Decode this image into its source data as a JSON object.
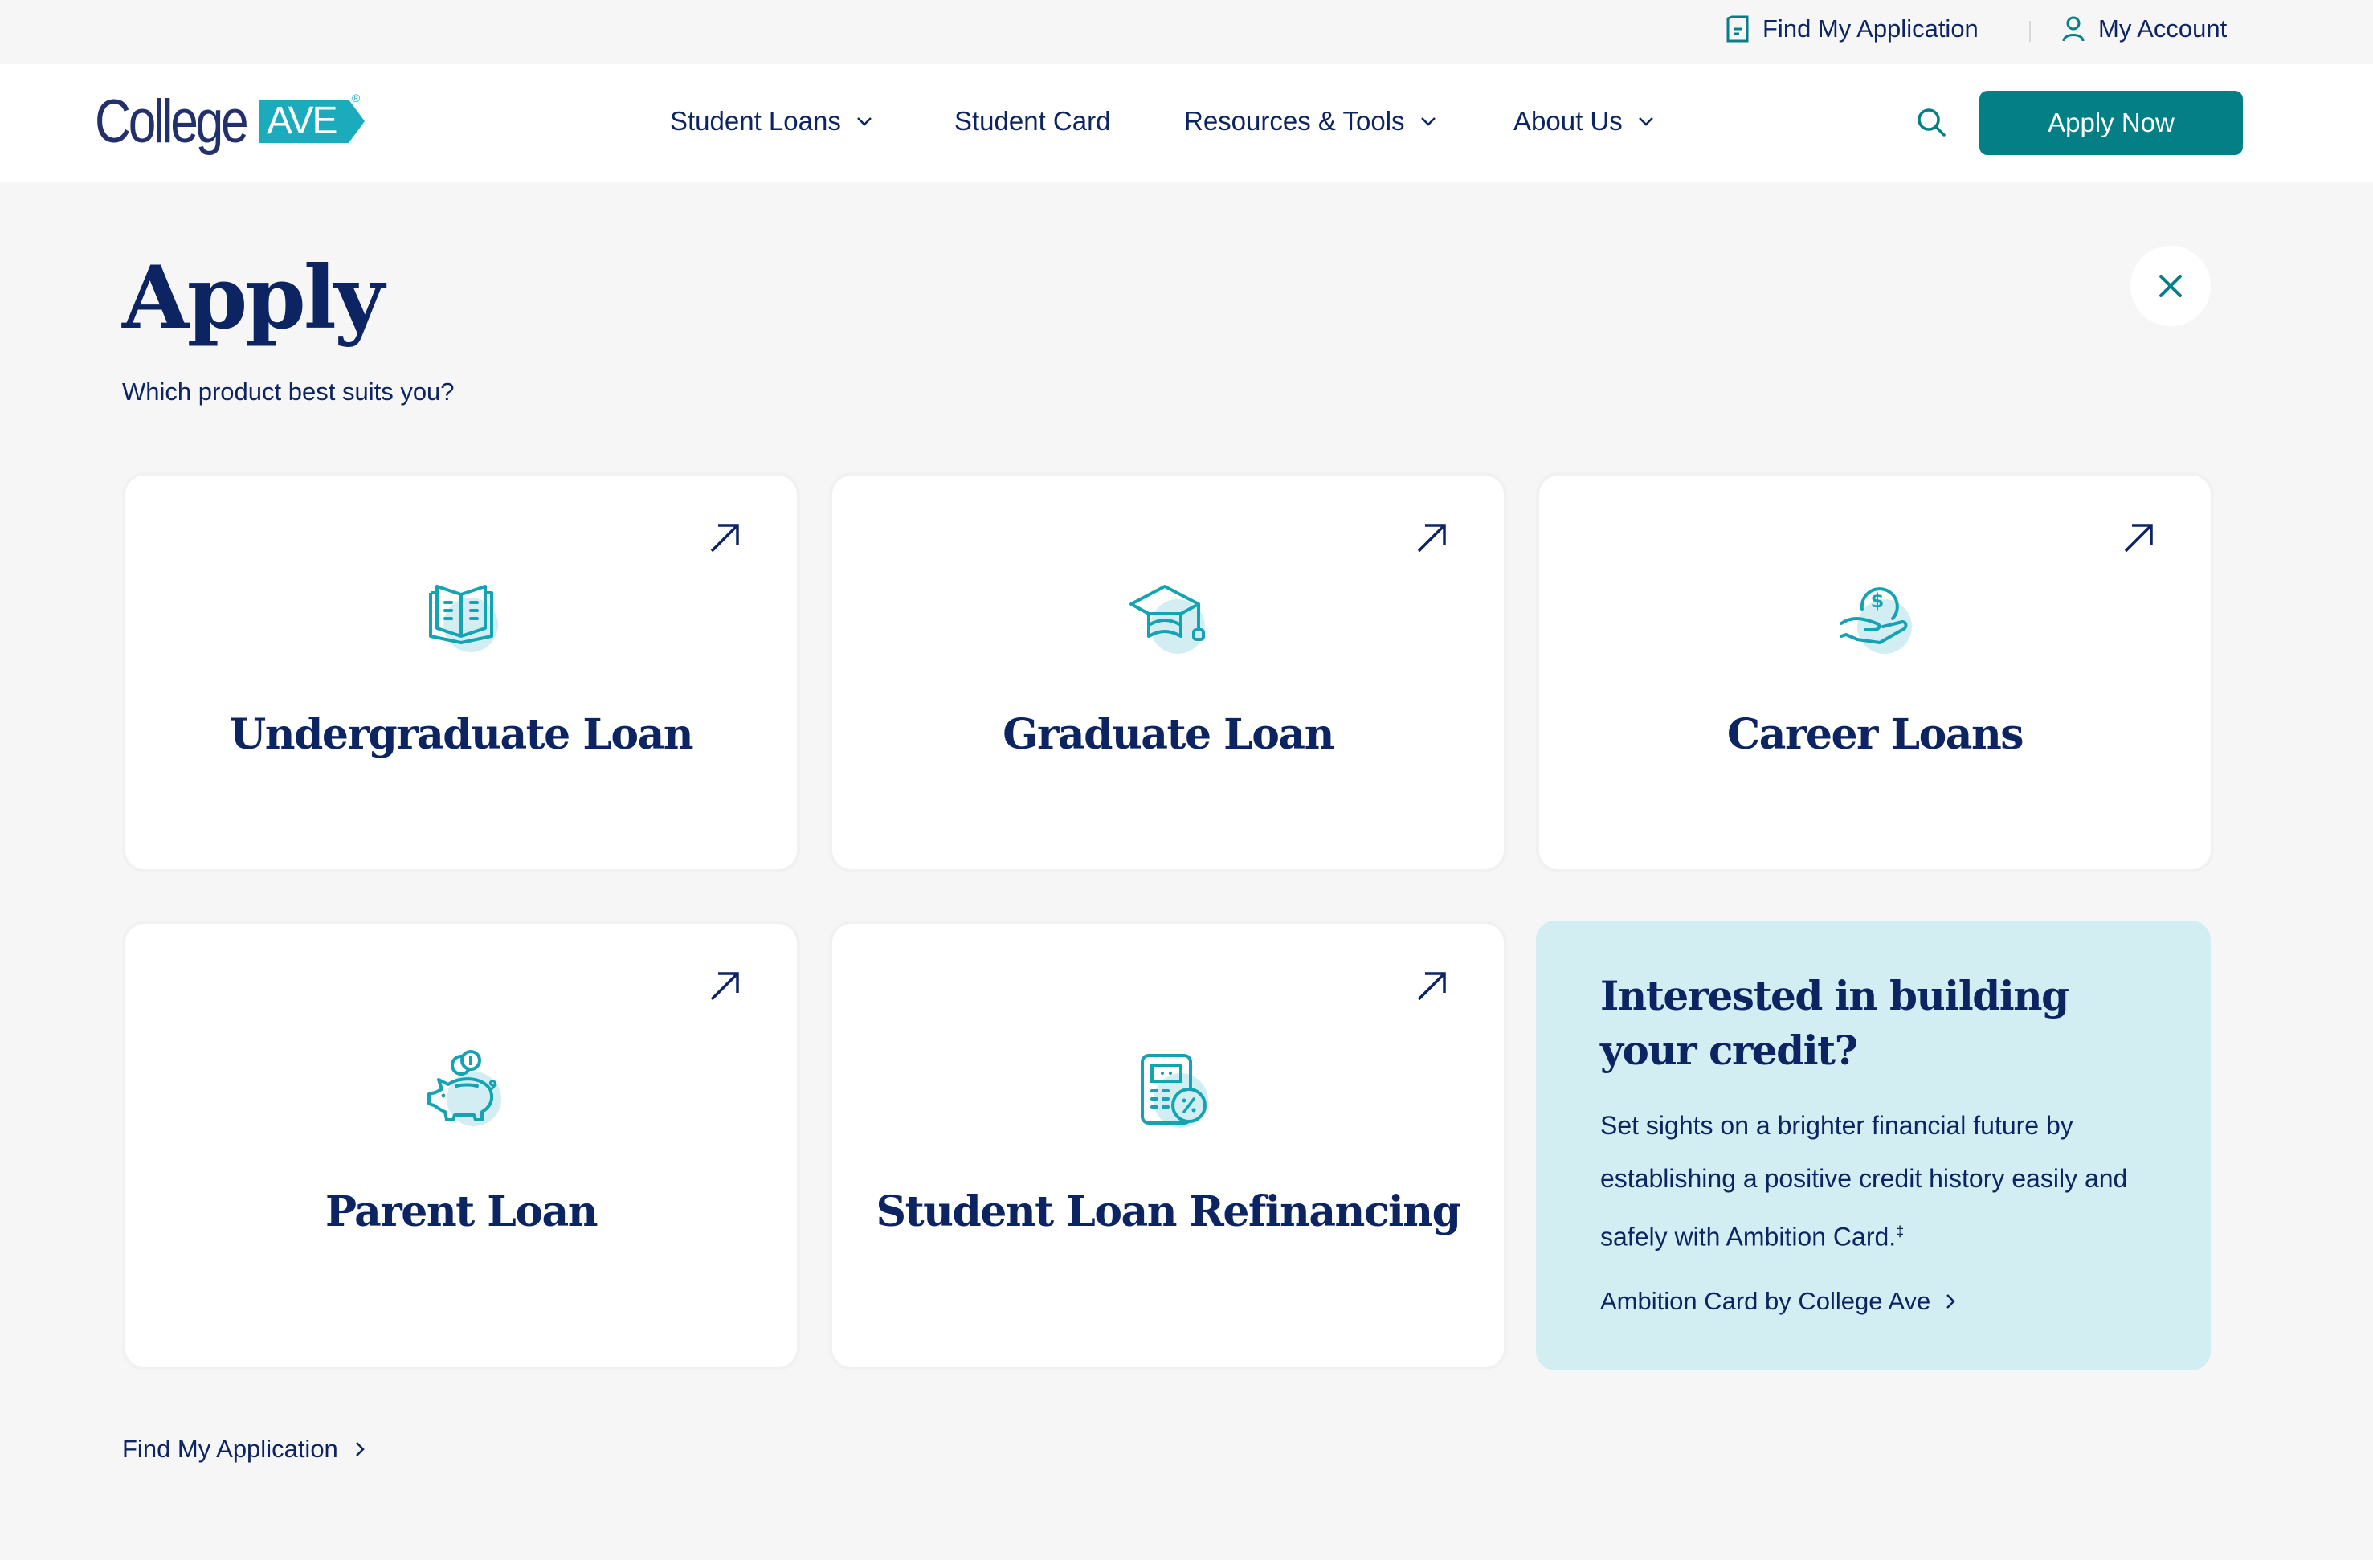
{
  "utility_bar": {
    "find_application": {
      "label": "Find My Application",
      "icon": "document-icon"
    },
    "my_account": {
      "label": "My Account",
      "icon": "user-icon"
    }
  },
  "header": {
    "logo": {
      "primary": "College",
      "badge": "AVE",
      "registered": "®"
    },
    "nav": [
      {
        "label": "Student Loans",
        "has_dropdown": true
      },
      {
        "label": "Student Card",
        "has_dropdown": false
      },
      {
        "label": "Resources & Tools",
        "has_dropdown": true
      },
      {
        "label": "About Us",
        "has_dropdown": true
      }
    ],
    "search_icon": "search-icon",
    "apply_now_label": "Apply Now"
  },
  "page": {
    "title": "Apply",
    "subtitle": "Which product best suits you?",
    "close_icon": "close-icon"
  },
  "products": [
    {
      "title": "Undergraduate Loan",
      "icon": "open-book-icon"
    },
    {
      "title": "Graduate Loan",
      "icon": "graduation-cap-icon"
    },
    {
      "title": "Career Loans",
      "icon": "hand-coin-icon"
    },
    {
      "title": "Parent Loan",
      "icon": "piggy-bank-icon"
    },
    {
      "title": "Student Loan Refinancing",
      "icon": "calculator-percent-icon"
    }
  ],
  "promo": {
    "title": "Interested in building your credit?",
    "body": "Set sights on a brighter financial future by establishing a positive credit history easily and safely with Ambition Card.",
    "footnote_mark": "‡",
    "link_label": "Ambition Card by College Ave"
  },
  "footer_link": {
    "label": "Find My Application"
  },
  "colors": {
    "navy": "#0c2461",
    "teal_button": "#047f86",
    "icon_teal": "#13a3b3",
    "icon_bubble": "#d3eef2",
    "promo_bg": "#d3eef2",
    "page_bg": "#f6f6f7",
    "logo_badge": "#1aabbd"
  }
}
